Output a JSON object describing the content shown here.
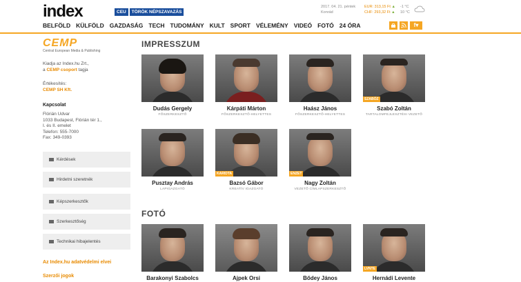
{
  "header": {
    "logo": "index",
    "tags": [
      "CEU",
      "TÖRÖK NÉPSZAVAZÁS"
    ],
    "date": "2017. 04. 21. péntek",
    "nameday": "Konrád",
    "eur": "EUR: 313,15 Ft",
    "chf": "CHF: 293,32 Ft",
    "temp_low": "-1 °C",
    "temp_high": "10 °C",
    "weather_icon": "cloud-icon"
  },
  "nav": {
    "items": [
      "BELFÖLD",
      "KÜLFÖLD",
      "GAZDASÁG",
      "TECH",
      "TUDOMÁNY",
      "KULT",
      "SPORT",
      "VÉLEMÉNY",
      "VIDEÓ",
      "FOTÓ",
      "24 ÓRA"
    ],
    "icons": [
      "shop-icon",
      "rss-icon",
      "facebook-icon"
    ],
    "fb_label": "f"
  },
  "sidebar": {
    "cemp_logo": "CEMP",
    "cemp_sub": "Central European Media & Publishing",
    "publisher_line": "Kiadja az Index.hu Zrt.,",
    "group_prefix": "a",
    "group_link": "CEMP csoport",
    "group_suffix": "tagja",
    "sales_label": "Értékesítés:",
    "sales_link": "CEMP SH Kft.",
    "contact_title": "Kapcsolat",
    "contact_lines": [
      "Flórián Udvar",
      "1033 Budapest, Flórián tér 1.,",
      "I. és II. emelet",
      "Telefon: 555-7000",
      "Fax: 349-0393"
    ],
    "menu": [
      "Kérdések",
      "Hirdetni szeretnék",
      "Képszerkesztők",
      "Szerkesztőség",
      "Technikai hibajelentés"
    ],
    "bottom_links": [
      "Az Index.hu adatvédelmi elvei",
      "Szerzői jogok"
    ]
  },
  "sections": [
    {
      "title": "IMPRESSZUM"
    },
    {
      "title": "FOTÓ"
    }
  ],
  "impresszum": [
    {
      "name": "Dudás Gergely",
      "role": "FŐSZERKESZTŐ",
      "badge": ""
    },
    {
      "name": "Kárpáti Márton",
      "role": "FŐSZERKESZTŐ-HELYETTES",
      "badge": ""
    },
    {
      "name": "Haász János",
      "role": "FŐSZERKESZTŐ-HELYETTES",
      "badge": ""
    },
    {
      "name": "Szabó Zoltán",
      "role": "TARTALOMFEJLESZTÉSI VEZETŐ",
      "badge": "SZABÓZ"
    },
    {
      "name": "Pusztay András",
      "role": "LAPIGAZGATÓ",
      "badge": ""
    },
    {
      "name": "Bazsó Gábor",
      "role": "KREATÍV IGAZGATÓ",
      "badge": "KARIDTA"
    },
    {
      "name": "Nagy Zoltán",
      "role": "VEZETŐ CÍMLAPSZERKESZTŐ",
      "badge": "ENZET"
    }
  ],
  "foto": [
    {
      "name": "Barakonyi Szabolcs",
      "role": "",
      "badge": ""
    },
    {
      "name": "Ajpek Orsi",
      "role": "",
      "badge": ""
    },
    {
      "name": "Bődey János",
      "role": "",
      "badge": ""
    },
    {
      "name": "Hernádi Levente",
      "role": "",
      "badge": "LVNTE"
    }
  ],
  "colors": {
    "accent": "#f5a623",
    "tag_blue": "#1a4e9c"
  }
}
